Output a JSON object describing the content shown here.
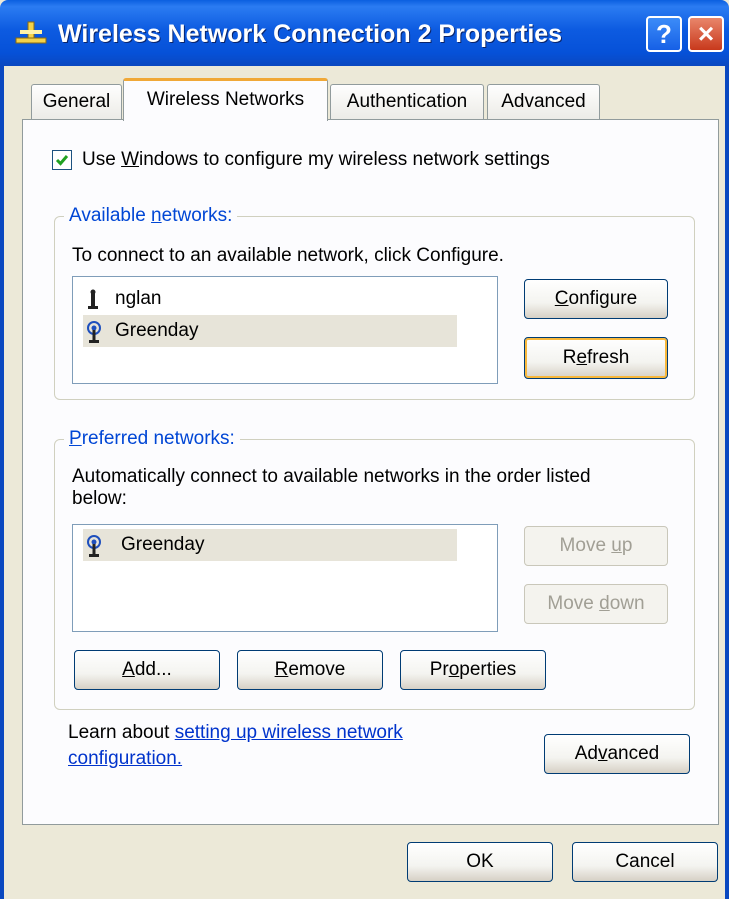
{
  "window": {
    "title": "Wireless Network Connection 2 Properties",
    "help_glyph": "?",
    "close_glyph": "×"
  },
  "tabs": [
    {
      "label": "General"
    },
    {
      "label": "Wireless Networks",
      "active": true
    },
    {
      "label": "Authentication"
    },
    {
      "label": "Advanced"
    }
  ],
  "use_windows": {
    "checked": true,
    "label_before": "Use ",
    "label_key": "W",
    "label_after": "indows to configure my wireless network settings"
  },
  "available": {
    "title_before": "Available ",
    "title_key": "n",
    "title_after": "etworks:",
    "description": "To connect to an available network, click Configure.",
    "networks": [
      {
        "name": "nglan",
        "icon": "infrastructure-icon"
      },
      {
        "name": "Greenday",
        "icon": "wireless-antenna-icon"
      }
    ],
    "configure": {
      "key": "C",
      "rest": "onfigure"
    },
    "refresh": {
      "before": "R",
      "key": "e",
      "after": "fresh"
    }
  },
  "preferred": {
    "title_before": "",
    "title_key": "P",
    "title_after": "referred networks:",
    "description_line1": "Automatically connect to available networks in the order listed",
    "description_line2": "below:",
    "networks": [
      {
        "name": "Greenday",
        "icon": "wireless-antenna-icon"
      }
    ],
    "move_up": {
      "before": "Move ",
      "key": "u",
      "after": "p"
    },
    "move_down": {
      "before": "Move ",
      "key": "d",
      "after": "own"
    },
    "add": {
      "key": "A",
      "after": "dd..."
    },
    "remove": {
      "key": "R",
      "after": "emove"
    },
    "properties": {
      "before": "Pr",
      "key": "o",
      "after": "perties"
    }
  },
  "learn": {
    "prefix": "Learn about ",
    "link_line1": "setting up wireless network",
    "link_line2": "configuration."
  },
  "advanced_button": {
    "before": "Ad",
    "key": "v",
    "after": "anced"
  },
  "footer": {
    "ok": "OK",
    "cancel": "Cancel"
  },
  "colors": {
    "titlebar": "#0a5fe0",
    "dialog_bg": "#ece9d8",
    "group_title": "#0046d5",
    "link": "#0033cc",
    "focus_ring": "#f8b83c"
  }
}
